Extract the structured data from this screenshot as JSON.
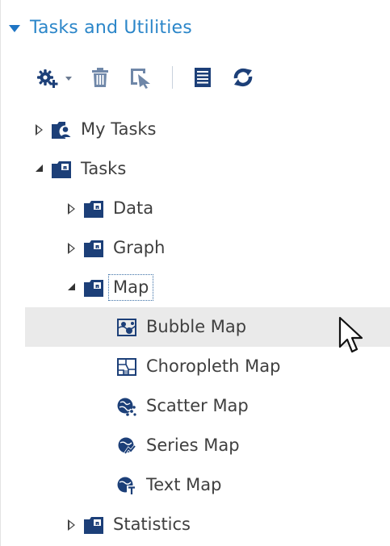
{
  "section": {
    "title": "Tasks and Utilities",
    "expanded": true
  },
  "toolbar": {
    "buttons": [
      {
        "icon": "new-task-icon",
        "has_dropdown": true
      },
      {
        "icon": "trash-icon"
      },
      {
        "icon": "edit-properties-icon"
      },
      {
        "icon": "list-view-icon"
      },
      {
        "icon": "refresh-icon"
      }
    ]
  },
  "tree": {
    "my_tasks": {
      "label": "My Tasks",
      "icon": "my-tasks-folder-icon",
      "expanded": false
    },
    "tasks": {
      "label": "Tasks",
      "icon": "tasks-folder-icon",
      "expanded": true
    },
    "data": {
      "label": "Data",
      "icon": "task-folder-icon",
      "expanded": false
    },
    "graph": {
      "label": "Graph",
      "icon": "task-folder-icon",
      "expanded": false
    },
    "map": {
      "label": "Map",
      "icon": "task-folder-icon",
      "expanded": true,
      "focused": true
    },
    "bubble_map": {
      "label": "Bubble Map",
      "icon": "bubble-map-icon",
      "hovered": true
    },
    "choropleth_map": {
      "label": "Choropleth Map",
      "icon": "choropleth-map-icon"
    },
    "scatter_map": {
      "label": "Scatter Map",
      "icon": "scatter-map-icon"
    },
    "series_map": {
      "label": "Series Map",
      "icon": "series-map-icon"
    },
    "text_map": {
      "label": "Text Map",
      "icon": "text-map-icon"
    },
    "statistics": {
      "label": "Statistics",
      "icon": "task-folder-icon",
      "expanded": false
    }
  },
  "colors": {
    "accent": "#1f75c4",
    "title": "#2b86c9",
    "icon_navy": "#1c3f78",
    "hover_row": "#eaeaea",
    "text": "#3f3f3f"
  }
}
